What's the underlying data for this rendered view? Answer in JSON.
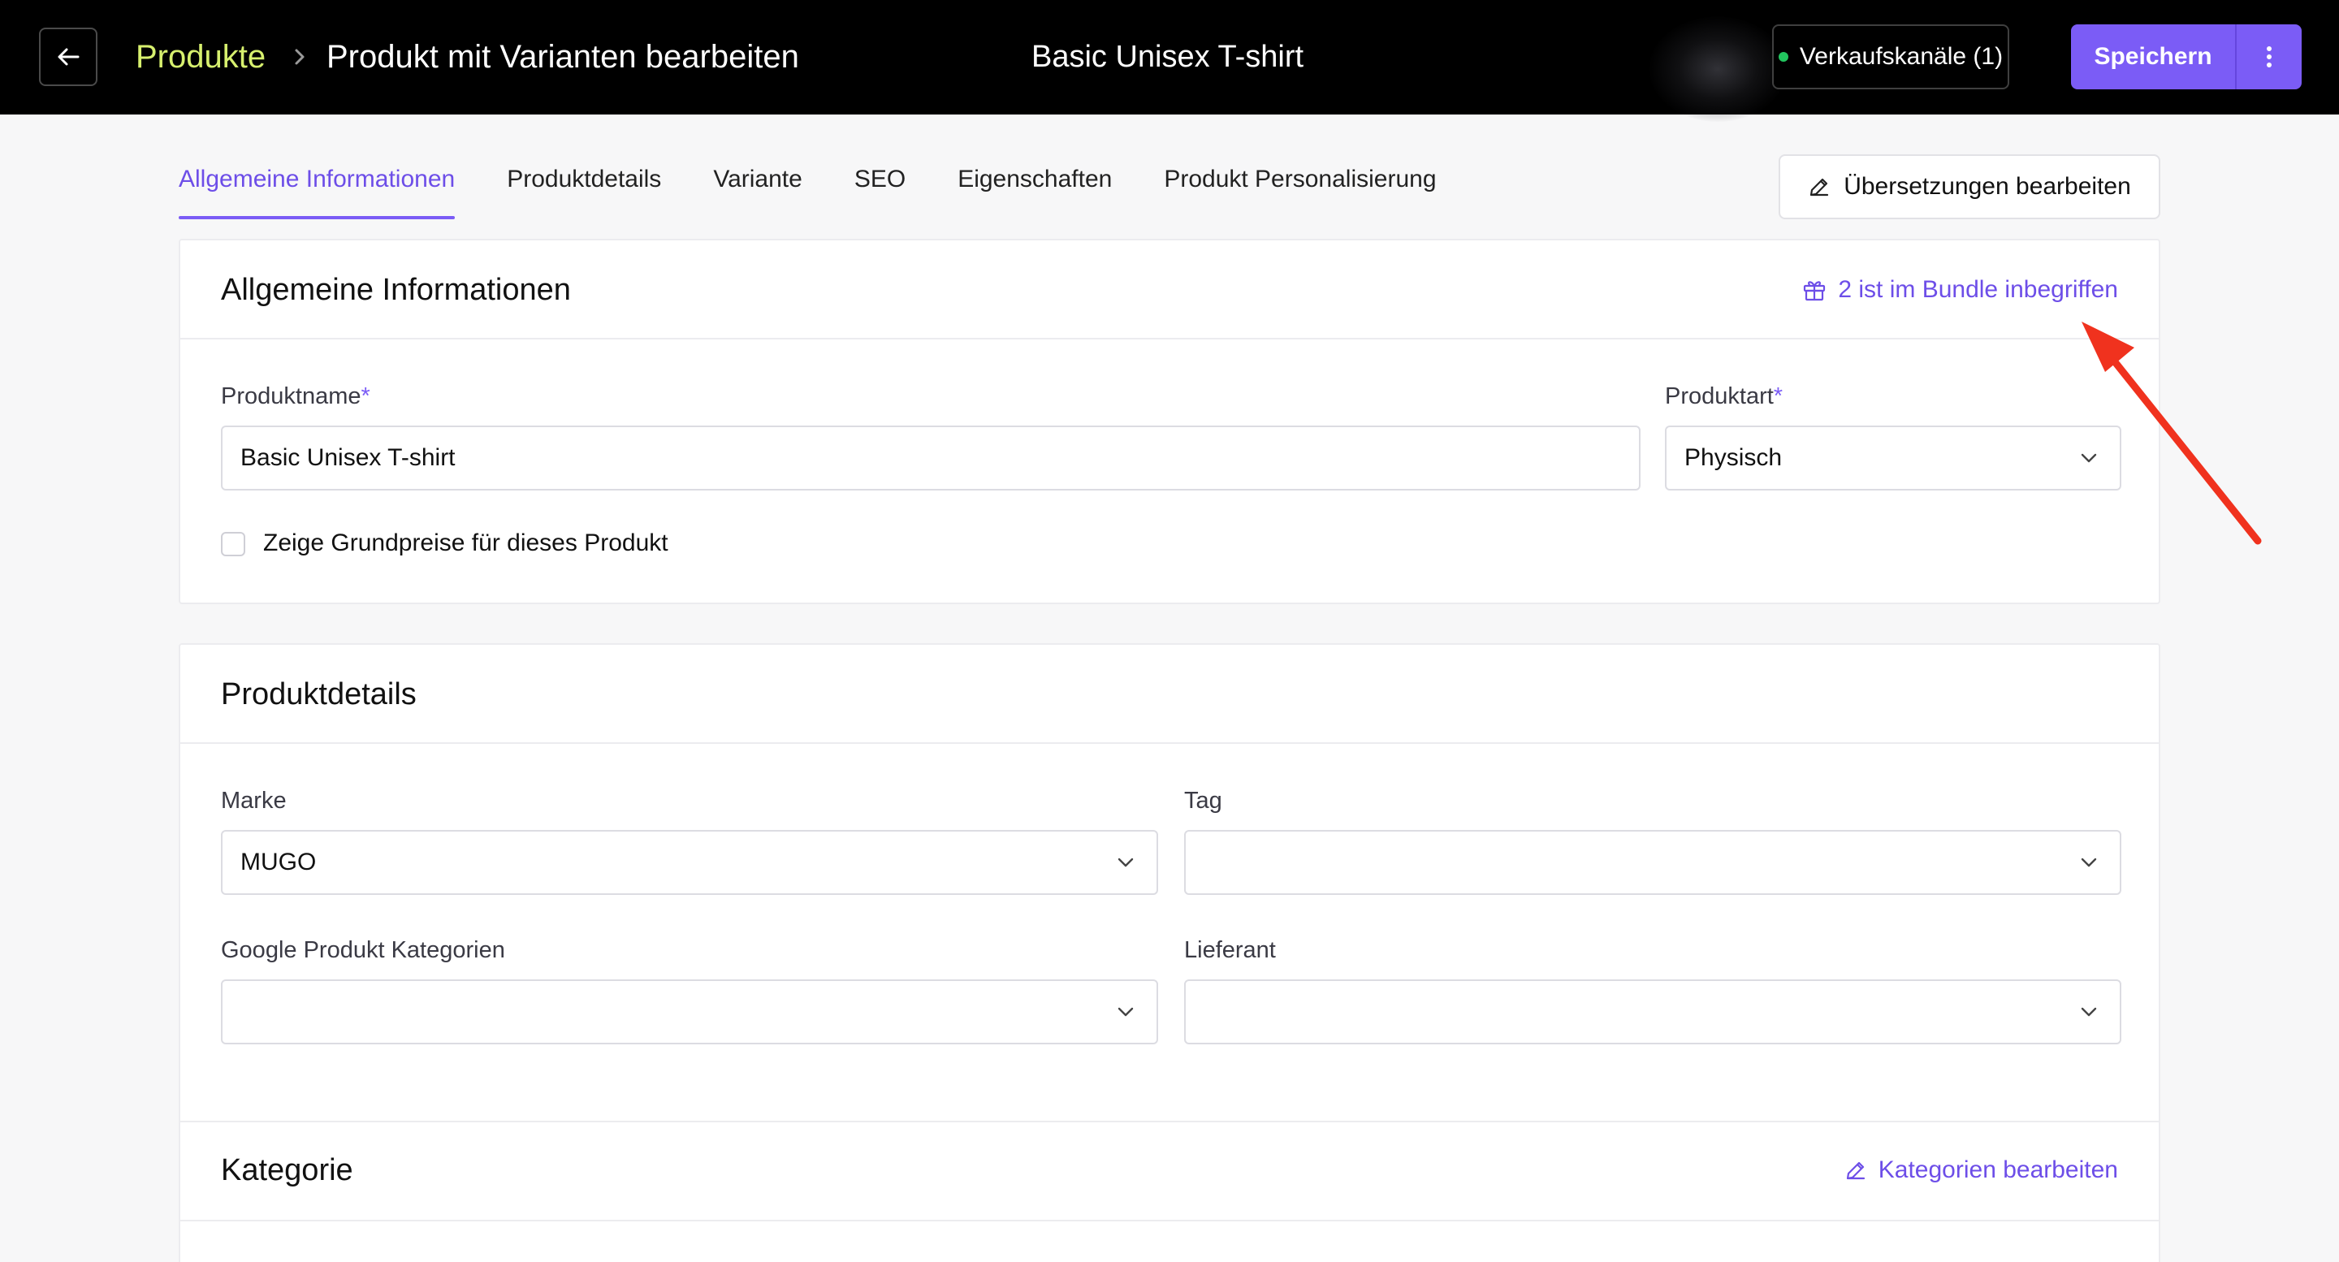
{
  "header": {
    "breadcrumb_link": "Produkte",
    "breadcrumb_current": "Produkt mit Varianten bearbeiten",
    "product_title": "Basic Unisex T-shirt",
    "channels_label": "Verkaufskanäle (1)",
    "save_label": "Speichern"
  },
  "tabs": [
    {
      "label": "Allgemeine Informationen",
      "active": true
    },
    {
      "label": "Produktdetails",
      "active": false
    },
    {
      "label": "Variante",
      "active": false
    },
    {
      "label": "SEO",
      "active": false
    },
    {
      "label": "Eigenschaften",
      "active": false
    },
    {
      "label": "Produkt Personalisierung",
      "active": false
    }
  ],
  "translate_label": "Übersetzungen bearbeiten",
  "general": {
    "title": "Allgemeine Informationen",
    "bundle_link": "2 ist im Bundle inbegriffen",
    "name_label": "Produktname",
    "name_value": "Basic Unisex T-shirt",
    "type_label": "Produktart",
    "type_value": "Physisch",
    "required_mark": "*",
    "baseprice_label": "Zeige Grundpreise für dieses Produkt"
  },
  "details": {
    "title": "Produktdetails",
    "brand_label": "Marke",
    "brand_value": "MUGO",
    "tag_label": "Tag",
    "tag_value": "",
    "google_label": "Google Produkt Kategorien",
    "google_value": "",
    "supplier_label": "Lieferant",
    "supplier_value": ""
  },
  "category": {
    "title": "Kategorie",
    "edit_link": "Kategorien bearbeiten"
  },
  "colors": {
    "accent": "#7b5cf6",
    "breadcrumb_link": "#d7f06e",
    "annotation_arrow": "#f0321e",
    "status_dot": "#22c55e"
  },
  "icons": [
    "arrow-left-icon",
    "chevron-right-icon",
    "dot-icon",
    "more-vertical-icon",
    "pencil-icon",
    "gift-icon",
    "chevron-down-icon"
  ]
}
